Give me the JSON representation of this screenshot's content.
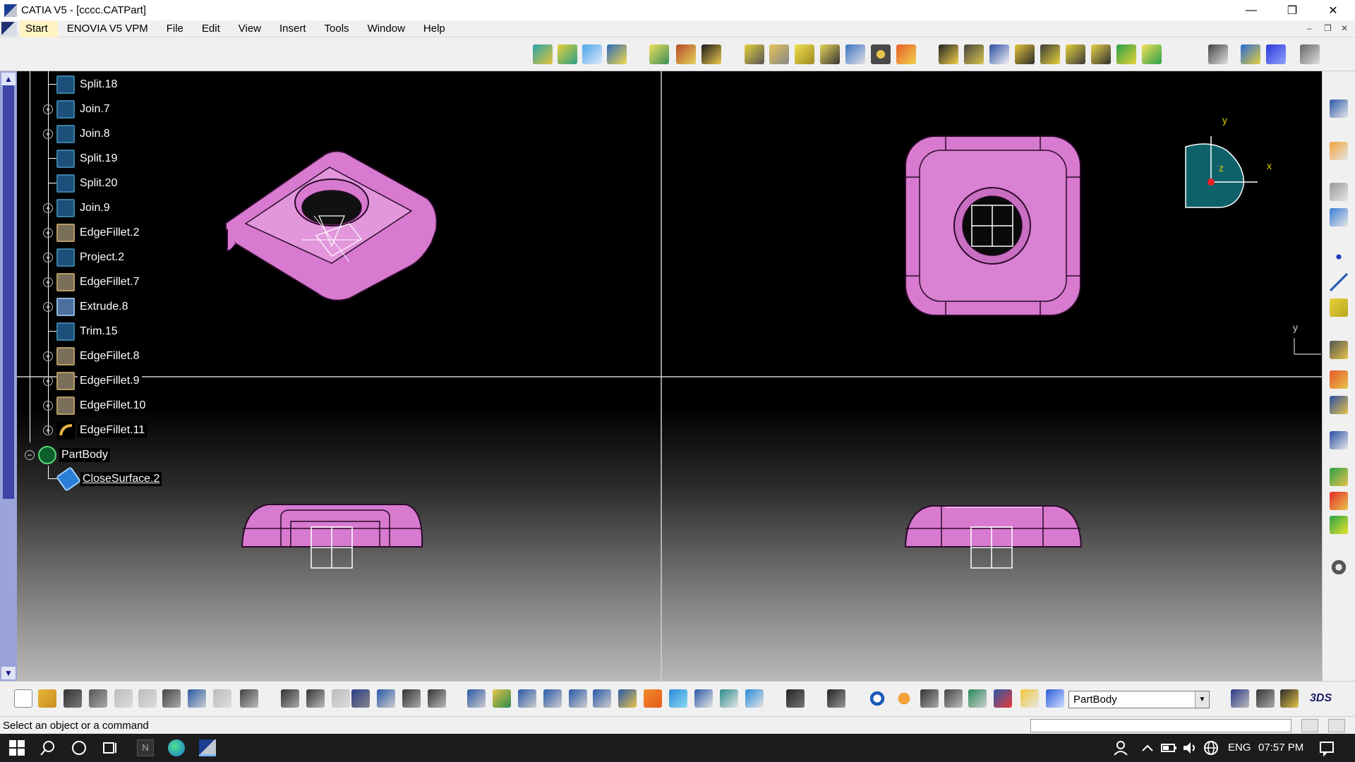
{
  "window": {
    "title": "CATIA V5 - [cccc.CATPart]",
    "controls": [
      "—",
      "❐",
      "✕"
    ]
  },
  "menu": {
    "items": [
      "Start",
      "ENOVIA V5 VPM",
      "File",
      "Edit",
      "View",
      "Insert",
      "Tools",
      "Window",
      "Help"
    ],
    "mdi_controls": [
      "–",
      "❐",
      "✕"
    ]
  },
  "tree": {
    "items": [
      {
        "label": "Split.18",
        "icon": "split-icon",
        "expandable": false
      },
      {
        "label": "Join.7",
        "icon": "join-icon",
        "expandable": true
      },
      {
        "label": "Join.8",
        "icon": "join-icon",
        "expandable": true
      },
      {
        "label": "Split.19",
        "icon": "split-icon",
        "expandable": false
      },
      {
        "label": "Split.20",
        "icon": "split-icon",
        "expandable": false
      },
      {
        "label": "Join.9",
        "icon": "join-icon",
        "expandable": true
      },
      {
        "label": "EdgeFillet.2",
        "icon": "edge-fillet-icon",
        "expandable": true
      },
      {
        "label": "Project.2",
        "icon": "project-icon",
        "expandable": true
      },
      {
        "label": "EdgeFillet.7",
        "icon": "edge-fillet-icon",
        "expandable": true
      },
      {
        "label": "Extrude.8",
        "icon": "extrude-icon",
        "expandable": true
      },
      {
        "label": "Trim.15",
        "icon": "trim-icon",
        "expandable": false
      },
      {
        "label": "EdgeFillet.8",
        "icon": "edge-fillet-icon",
        "expandable": true
      },
      {
        "label": "EdgeFillet.9",
        "icon": "edge-fillet-icon",
        "expandable": true
      },
      {
        "label": "EdgeFillet.10",
        "icon": "edge-fillet-icon",
        "expandable": true
      },
      {
        "label": "EdgeFillet.11",
        "icon": "edge-fillet-icon",
        "expandable": true
      }
    ],
    "partbody": "PartBody",
    "closesurface": "CloseSurface.2"
  },
  "compass": {
    "x_label": "x",
    "y_label": "y",
    "z_label": "z"
  },
  "axis_label": "y",
  "toolbar": {
    "current_body": "PartBody"
  },
  "status": {
    "message": "Select an object or a command"
  },
  "taskbar": {
    "language": "ENG",
    "time": "07:57 PM"
  },
  "colors": {
    "part_fill": "#d77ad0",
    "part_edge": "#2a0a28",
    "title_bg": "#ffffff",
    "menu_bg": "#f0f0f0",
    "start_highlight": "#fff3c4"
  }
}
